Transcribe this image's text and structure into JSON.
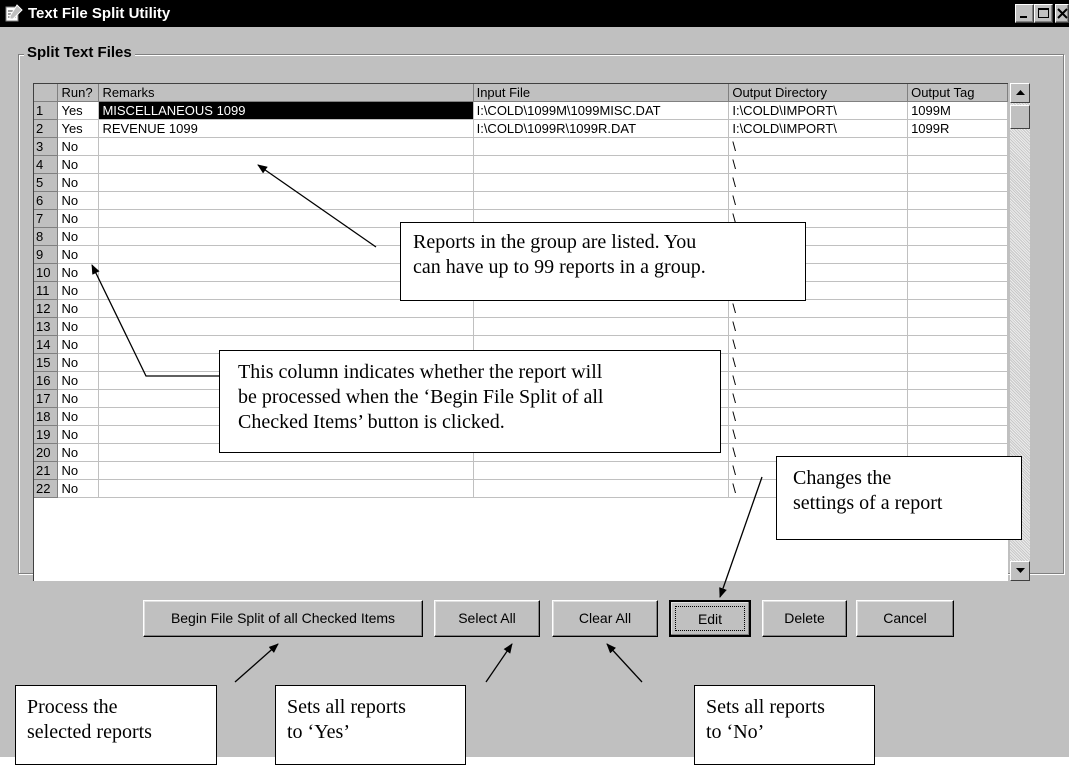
{
  "window": {
    "title": "Text File Split Utility",
    "icon": "utility-icon",
    "controls": [
      "minimize-icon",
      "maximize-icon",
      "close-icon"
    ]
  },
  "group": {
    "title": "Split Text Files"
  },
  "grid": {
    "columns": [
      "",
      "Run?",
      "Remarks",
      "Input File",
      "Output Directory",
      "Output Tag"
    ],
    "rows": [
      [
        "1",
        "Yes",
        "MISCELLANEOUS 1099",
        "I:\\COLD\\1099M\\1099MISC.DAT",
        "I:\\COLD\\IMPORT\\",
        "1099M"
      ],
      [
        "2",
        "Yes",
        "REVENUE 1099",
        "I:\\COLD\\1099R\\1099R.DAT",
        "I:\\COLD\\IMPORT\\",
        "1099R"
      ],
      [
        "3",
        "No",
        "",
        "",
        "\\",
        ""
      ],
      [
        "4",
        "No",
        "",
        "",
        "\\",
        ""
      ],
      [
        "5",
        "No",
        "",
        "",
        "\\",
        ""
      ],
      [
        "6",
        "No",
        "",
        "",
        "\\",
        ""
      ],
      [
        "7",
        "No",
        "",
        "",
        "\\",
        ""
      ],
      [
        "8",
        "No",
        "",
        "",
        "\\",
        ""
      ],
      [
        "9",
        "No",
        "",
        "",
        "\\",
        ""
      ],
      [
        "10",
        "No",
        "",
        "",
        "\\",
        ""
      ],
      [
        "11",
        "No",
        "",
        "",
        "\\",
        ""
      ],
      [
        "12",
        "No",
        "",
        "",
        "\\",
        ""
      ],
      [
        "13",
        "No",
        "",
        "",
        "\\",
        ""
      ],
      [
        "14",
        "No",
        "",
        "",
        "\\",
        ""
      ],
      [
        "15",
        "No",
        "",
        "",
        "\\",
        ""
      ],
      [
        "16",
        "No",
        "",
        "",
        "\\",
        ""
      ],
      [
        "17",
        "No",
        "",
        "",
        "\\",
        ""
      ],
      [
        "18",
        "No",
        "",
        "",
        "\\",
        ""
      ],
      [
        "19",
        "No",
        "",
        "",
        "\\",
        ""
      ],
      [
        "20",
        "No",
        "",
        "",
        "\\",
        ""
      ],
      [
        "21",
        "No",
        "",
        "",
        "\\",
        ""
      ],
      [
        "22",
        "No",
        "",
        "",
        "\\",
        ""
      ]
    ],
    "selected_row": 0
  },
  "buttons": {
    "begin": "Begin File Split of all Checked Items",
    "select_all": "Select All",
    "clear_all": "Clear All",
    "edit": "Edit",
    "delete": "Delete",
    "cancel": "Cancel"
  },
  "annotations": {
    "reports_line1": "Reports in the group are listed. You",
    "reports_line2": "can have up to 99 reports in a group.",
    "runcol_line1": "This column indicates whether the report will",
    "runcol_line2": "be processed when the ‘Begin File Split of all",
    "runcol_line3": "Checked Items’ button is clicked.",
    "edit_line1": "Changes the",
    "edit_line2": "settings of a report",
    "process_line1": "Process the",
    "process_line2": "selected reports",
    "yes_line1": "Sets all reports",
    "yes_line2": "to ‘Yes’",
    "no_line1": "Sets all reports",
    "no_line2": "to ‘No’"
  },
  "colors": {
    "window_face": "#c0c0c0",
    "titlebar": "#000000",
    "selection": "#000000"
  }
}
